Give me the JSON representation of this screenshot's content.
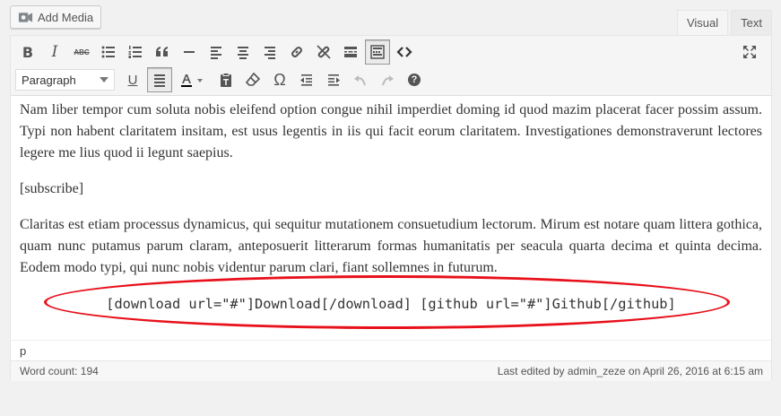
{
  "add_media": {
    "label": "Add Media"
  },
  "tabs": [
    {
      "label": "Visual",
      "active": true
    },
    {
      "label": "Text",
      "active": false
    }
  ],
  "toolbar": {
    "row1": [
      "bold-icon",
      "italic-icon",
      "strikethrough-icon",
      "bulleted-list-icon",
      "numbered-list-icon",
      "blockquote-icon",
      "horizontal-line-icon",
      "align-left-icon",
      "align-center-icon",
      "align-right-icon",
      "insert-link-icon",
      "remove-link-icon",
      "read-more-icon",
      "toolbar-toggle-icon",
      "code-icon",
      "fullscreen-icon"
    ],
    "format_select": {
      "value": "Paragraph"
    },
    "row2": [
      "underline-icon",
      "justify-icon",
      "text-color-icon",
      "paste-text-icon",
      "clear-formatting-icon",
      "special-character-icon",
      "decrease-indent-icon",
      "increase-indent-icon",
      "undo-icon",
      "redo-icon",
      "help-icon"
    ],
    "text_color_swatch": "#000000",
    "bold_label": "B",
    "italic_label": "I",
    "strike_label": "ABC",
    "underline_label": "U",
    "omega_label": "Ω",
    "help_label": "?"
  },
  "content": {
    "paragraphs": [
      "Nam liber tempor cum soluta nobis eleifend option congue nihil imperdiet doming id quod mazim placerat facer possim assum. Typi non habent claritatem insitam, est usus legentis in iis qui facit eorum claritatem. Investigationes demonstraverunt lectores legere me lius quod ii legunt saepius.",
      "[subscribe]",
      "Claritas est etiam processus dynamicus, qui sequitur mutationem consuetudium lectorum. Mirum est notare quam littera gothica, quam nunc putamus parum claram, anteposuerit litterarum formas humanitatis per seacula quarta decima et quinta decima. Eodem modo typi, qui nunc nobis videntur parum clari, fiant sollemnes in futurum."
    ],
    "shortcode": "[download url=\"#\"]Download[/download] [github url=\"#\"]Github[/github]",
    "highlight_color": "#e8101a"
  },
  "path": "p",
  "status": {
    "word_count": "Word count: 194",
    "last_edited": "Last edited by admin_zeze on April 26, 2016 at 6:15 am"
  }
}
